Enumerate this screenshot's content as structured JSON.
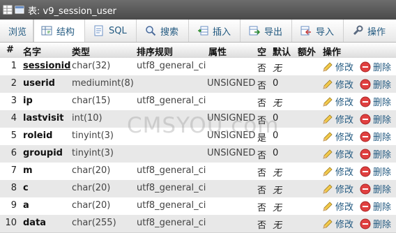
{
  "window": {
    "title": "表: v9_session_user"
  },
  "tabs": [
    {
      "label": "浏览",
      "icon": "browse-icon"
    },
    {
      "label": "结构",
      "icon": "structure-icon",
      "active": true
    },
    {
      "label": "SQL",
      "icon": "sql-icon"
    },
    {
      "label": "搜索",
      "icon": "search-icon"
    },
    {
      "label": "插入",
      "icon": "insert-icon"
    },
    {
      "label": "导出",
      "icon": "export-icon"
    },
    {
      "label": "导入",
      "icon": "import-icon"
    },
    {
      "label": "操作",
      "icon": "operations-icon"
    }
  ],
  "table": {
    "headers": {
      "num": "#",
      "name": "名字",
      "type": "类型",
      "collation": "排序规则",
      "attributes": "属性",
      "null": "空",
      "default": "默认",
      "extra": "额外",
      "action": "操作"
    },
    "actions": {
      "edit": "修改",
      "delete": "删除"
    },
    "rows": [
      {
        "num": "1",
        "name": "sessionid",
        "type": "char(32)",
        "collation": "utf8_general_ci",
        "attributes": "",
        "null": "否",
        "default": "无"
      },
      {
        "num": "2",
        "name": "userid",
        "type": "mediumint(8)",
        "collation": "",
        "attributes": "UNSIGNED",
        "null": "否",
        "default": "0"
      },
      {
        "num": "3",
        "name": "ip",
        "type": "char(15)",
        "collation": "utf8_general_ci",
        "attributes": "",
        "null": "否",
        "default": "无"
      },
      {
        "num": "4",
        "name": "lastvisit",
        "type": "int(10)",
        "collation": "",
        "attributes": "UNSIGNED",
        "null": "否",
        "default": "0"
      },
      {
        "num": "5",
        "name": "roleid",
        "type": "tinyint(3)",
        "collation": "",
        "attributes": "UNSIGNED",
        "null": "是",
        "default": "0"
      },
      {
        "num": "6",
        "name": "groupid",
        "type": "tinyint(3)",
        "collation": "",
        "attributes": "UNSIGNED",
        "null": "否",
        "default": "0"
      },
      {
        "num": "7",
        "name": "m",
        "type": "char(20)",
        "collation": "utf8_general_ci",
        "attributes": "",
        "null": "否",
        "default": "无"
      },
      {
        "num": "8",
        "name": "c",
        "type": "char(20)",
        "collation": "utf8_general_ci",
        "attributes": "",
        "null": "否",
        "default": "无"
      },
      {
        "num": "9",
        "name": "a",
        "type": "char(20)",
        "collation": "utf8_general_ci",
        "attributes": "",
        "null": "否",
        "default": "无"
      },
      {
        "num": "10",
        "name": "data",
        "type": "char(255)",
        "collation": "utf8_general_ci",
        "attributes": "",
        "null": "否",
        "default": "无"
      }
    ]
  },
  "watermark": "CMSYOU.com"
}
